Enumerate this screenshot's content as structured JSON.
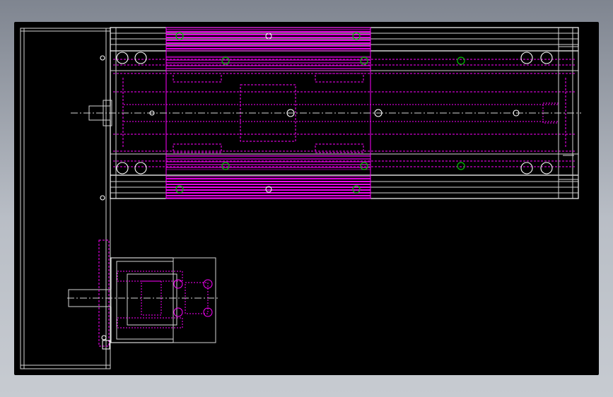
{
  "drawing": {
    "colors": {
      "background": "#000000",
      "frame": "#d4d4d4",
      "outline": "#ffffff",
      "hidden": "#ff00ff",
      "screw": "#00c000",
      "backdrop": "#9aa0a8"
    },
    "icons": [
      "screw-hole-icon",
      "bolt-icon"
    ],
    "dim_labels": {
      "top": "",
      "bottom": ""
    }
  }
}
